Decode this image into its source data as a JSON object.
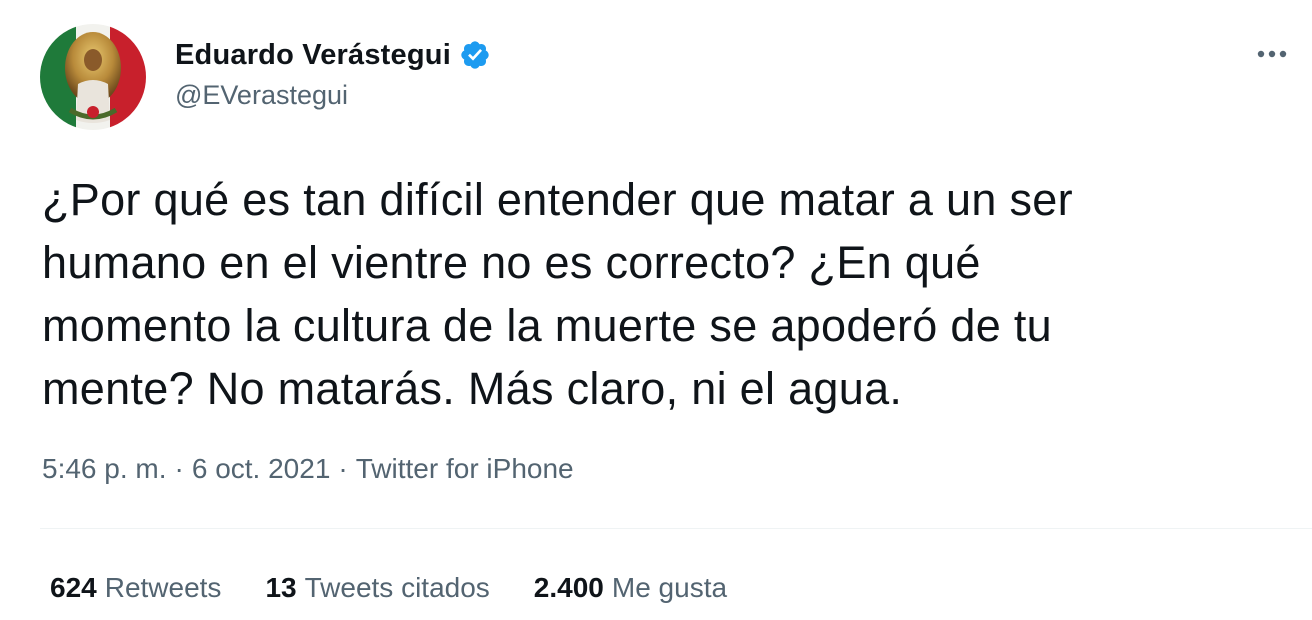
{
  "author": {
    "display_name": "Eduardo Verástegui",
    "handle": "@EVerastegui",
    "verified": true
  },
  "tweet": {
    "text": "¿Por qué es tan difícil entender que matar a un ser\nhumano en el vientre no es correcto? ¿En qué\nmomento la cultura de la muerte se apoderó de tu\nmente? No matarás. Más claro, ni el agua."
  },
  "meta": {
    "time": "5:46 p. m.",
    "separator": "·",
    "date": "6 oct. 2021",
    "source": "Twitter for iPhone"
  },
  "stats": {
    "retweets_count": "624",
    "retweets_label": "Retweets",
    "quotes_count": "13",
    "quotes_label": "Tweets citados",
    "likes_count": "2.400",
    "likes_label": "Me gusta"
  },
  "icons": {
    "verified": "verified-badge-icon",
    "more": "more-options-icon"
  },
  "colors": {
    "text_primary": "#0f1419",
    "text_secondary": "#536471",
    "verified_blue": "#1d9bf0",
    "divider": "#eff3f4"
  }
}
